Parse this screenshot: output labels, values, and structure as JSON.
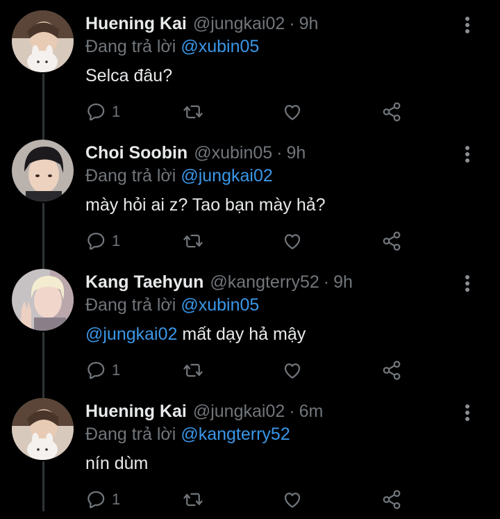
{
  "colors": {
    "background": "#000000",
    "name": "#e7e9ea",
    "secondary": "#71767b",
    "link": "#3a97e8",
    "divider": "#2f3336"
  },
  "tweets": [
    {
      "name": "Huening Kai",
      "handle": "@jungkai02",
      "sep": "·",
      "time": "9h",
      "reply_label": "Đang trả lời",
      "reply_to": "@xubin05",
      "mention": "",
      "text": "Selca đâu?",
      "reply_count": "1",
      "avatar_icon": "avatar-photo-icon"
    },
    {
      "name": "Choi Soobin",
      "handle": "@xubin05",
      "sep": "·",
      "time": "9h",
      "reply_label": "Đang trả lời",
      "reply_to": "@jungkai02",
      "mention": "",
      "text": "mày hỏi ai z? Tao bạn mày hả?",
      "reply_count": "1",
      "avatar_icon": "avatar-photo-icon"
    },
    {
      "name": "Kang Taehyun",
      "handle": "@kangterry52",
      "sep": "·",
      "time": "9h",
      "reply_label": "Đang trả lời",
      "reply_to": "@xubin05",
      "mention": "@jungkai02",
      "text": "mất dạy hả mậy",
      "reply_count": "1",
      "avatar_icon": "avatar-photo-icon"
    },
    {
      "name": "Huening Kai",
      "handle": "@jungkai02",
      "sep": "·",
      "time": "6m",
      "reply_label": "Đang trả lời",
      "reply_to": "@kangterry52",
      "mention": "",
      "text": "nín dùm",
      "reply_count": "1",
      "avatar_icon": "avatar-photo-icon"
    }
  ],
  "icons": [
    "reply-icon",
    "retweet-icon",
    "like-icon",
    "share-icon",
    "more-options-icon"
  ]
}
